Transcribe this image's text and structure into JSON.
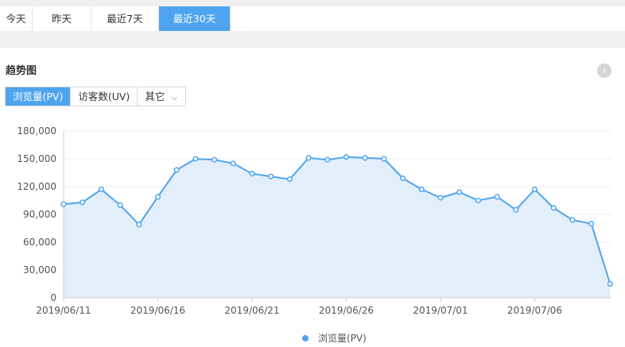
{
  "tabs": [
    {
      "label": "今天",
      "active": false
    },
    {
      "label": "昨天",
      "active": false
    },
    {
      "label": "最近7天",
      "active": false
    },
    {
      "label": "最近30天",
      "active": true
    }
  ],
  "section": {
    "title": "趋势图",
    "next_icon": "chevron-right-circle-icon"
  },
  "metrics": {
    "pv": "浏览量(PV)",
    "uv": "访客数(UV)",
    "other": "其它",
    "other_icon": "chevron-down-icon"
  },
  "chart_data": {
    "type": "area",
    "series": [
      {
        "name": "浏览量(PV)",
        "color": "#4ea4ef",
        "values": [
          101000,
          103000,
          117000,
          100000,
          79000,
          109000,
          138000,
          150000,
          149000,
          145000,
          134000,
          131000,
          128000,
          151000,
          149000,
          152000,
          151000,
          150000,
          129000,
          117000,
          108000,
          114000,
          105000,
          109000,
          95000,
          117000,
          97000,
          84000,
          80000,
          15000
        ]
      }
    ],
    "x": [
      "2019/06/11",
      "2019/06/12",
      "2019/06/13",
      "2019/06/14",
      "2019/06/15",
      "2019/06/16",
      "2019/06/17",
      "2019/06/18",
      "2019/06/19",
      "2019/06/20",
      "2019/06/21",
      "2019/06/22",
      "2019/06/23",
      "2019/06/24",
      "2019/06/25",
      "2019/06/26",
      "2019/06/27",
      "2019/06/28",
      "2019/06/29",
      "2019/06/30",
      "2019/07/01",
      "2019/07/02",
      "2019/07/03",
      "2019/07/04",
      "2019/07/05",
      "2019/07/06",
      "2019/07/07",
      "2019/07/08",
      "2019/07/09",
      "2019/07/10"
    ],
    "x_tick_labels": [
      "2019/06/11",
      "2019/06/16",
      "2019/06/21",
      "2019/06/26",
      "2019/07/01",
      "2019/07/06"
    ],
    "y_tick_labels": [
      "0",
      "30,000",
      "60,000",
      "90,000",
      "120,000",
      "150,000",
      "180,000"
    ],
    "ylim": [
      0,
      180000
    ],
    "grid": true,
    "legend_position": "bottom-center",
    "fill_color": "#e3eefb"
  }
}
